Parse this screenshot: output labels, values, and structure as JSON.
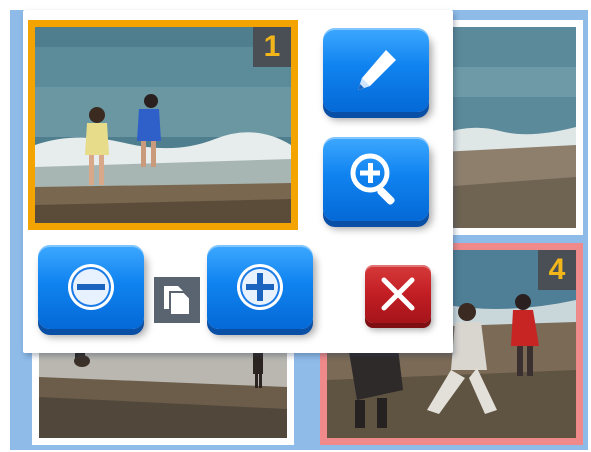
{
  "thumbnails": [
    {
      "id": "1",
      "badge": "1",
      "selected": true,
      "highlight_color": "#f3a400"
    },
    {
      "id": "2",
      "badge": "",
      "selected": false
    },
    {
      "id": "3",
      "badge": "",
      "selected": false
    },
    {
      "id": "4",
      "badge": "4",
      "selected": false,
      "highlight_color": "#f08a8a"
    }
  ],
  "menu": {
    "buttons": [
      {
        "name": "edit",
        "icon": "pencil-icon"
      },
      {
        "name": "zoom-in",
        "icon": "magnifier-plus-icon"
      },
      {
        "name": "decrease",
        "icon": "minus-circle-icon"
      },
      {
        "name": "copy",
        "icon": "copy-pages-icon"
      },
      {
        "name": "increase",
        "icon": "plus-circle-icon"
      },
      {
        "name": "close",
        "icon": "close-x-icon"
      }
    ]
  },
  "colors": {
    "background": "#8fbbe9",
    "button_blue": "#1083f0",
    "button_red": "#c21e24",
    "selection": "#f3a400",
    "badge_bg": "#4a4f55",
    "badge_text": "#f2b61a"
  }
}
